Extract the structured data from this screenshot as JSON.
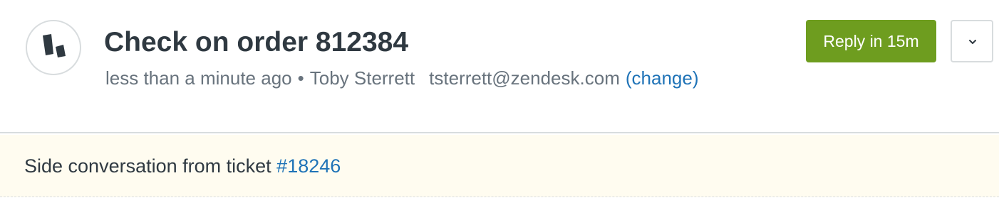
{
  "header": {
    "title": "Check on order 812384",
    "meta": {
      "time": "less than a minute ago",
      "separator": "•",
      "name": "Toby Sterrett",
      "email": "tsterrett@zendesk.com",
      "change_label": "(change)"
    },
    "reply_button_label": "Reply in 15m",
    "reply_button_color": "#6e9d1f",
    "menu_icon": "chevron-down-icon",
    "avatar_icon": "zendesk-logo-icon"
  },
  "banner": {
    "text": "Side conversation from ticket",
    "ticket_link": "#18246",
    "background": "#fffcf0"
  },
  "colors": {
    "link": "#1f73b7",
    "text_primary": "#2f3941",
    "text_secondary": "#68737d",
    "border": "#d8dcde"
  }
}
